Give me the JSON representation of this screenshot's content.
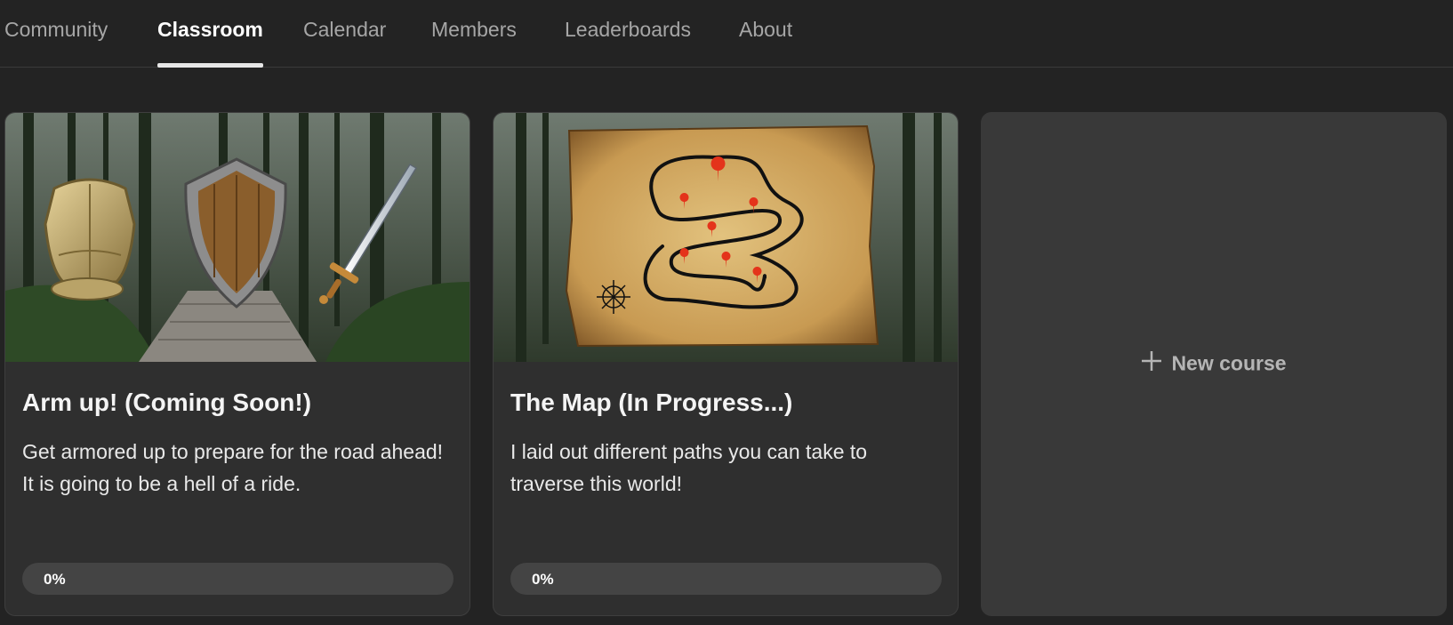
{
  "nav": {
    "tabs": [
      {
        "label": "Community",
        "active": false
      },
      {
        "label": "Classroom",
        "active": true
      },
      {
        "label": "Calendar",
        "active": false
      },
      {
        "label": "Members",
        "active": false
      },
      {
        "label": "Leaderboards",
        "active": false
      },
      {
        "label": "About",
        "active": false
      }
    ]
  },
  "courses": [
    {
      "title": "Arm up! (Coming Soon!)",
      "description": "Get armored up to prepare for the road ahead! It is going to be a hell of a ride.",
      "progress": 0,
      "progress_label": "0%",
      "cover_icons": [
        "chest-armor-icon",
        "wooden-shield-icon",
        "sword-icon"
      ]
    },
    {
      "title": "The Map (In Progress...)",
      "description": "I laid out different paths you can take to traverse this world!",
      "progress": 0,
      "progress_label": "0%",
      "cover_icons": [
        "treasure-map-icon",
        "compass-rose-icon",
        "map-pin-icon"
      ]
    }
  ],
  "new_course": {
    "label": "New course",
    "icon": "plus-icon"
  },
  "colors": {
    "background": "#232323",
    "card": "#2f2f2f",
    "new_course_card": "#393939",
    "progress_track": "#444444",
    "tab_inactive": "#a6a6a6",
    "tab_active": "#ffffff",
    "map_pin": "#e4331b"
  }
}
